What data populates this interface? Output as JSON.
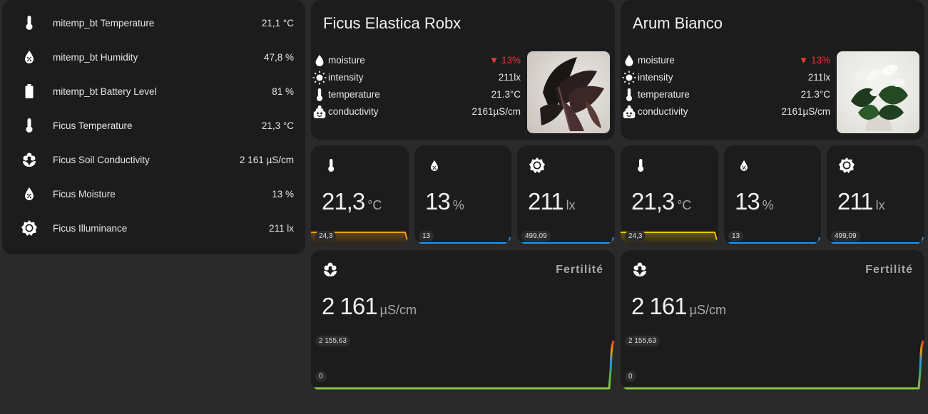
{
  "entities": [
    {
      "name": "mitemp_bt Temperature",
      "value": "21,1 °C",
      "icon": "thermometer-icon"
    },
    {
      "name": "mitemp_bt Humidity",
      "value": "47,8 %",
      "icon": "water-percent-icon"
    },
    {
      "name": "mitemp_bt Battery Level",
      "value": "81 %",
      "icon": "battery-icon"
    },
    {
      "name": "Ficus Temperature",
      "value": "21,3 °C",
      "icon": "thermometer-icon"
    },
    {
      "name": "Ficus Soil Conductivity",
      "value": "2 161 µS/cm",
      "icon": "flower-icon"
    },
    {
      "name": "Ficus Moisture",
      "value": "13 %",
      "icon": "water-percent-icon"
    },
    {
      "name": "Ficus Illuminance",
      "value": "211 lx",
      "icon": "brightness-icon"
    }
  ],
  "plants": [
    {
      "title": "Ficus Elastica Robx",
      "rows": [
        {
          "label": "moisture",
          "value": "13%",
          "alert": true,
          "icon": "water-icon"
        },
        {
          "label": "intensity",
          "value": "211lx",
          "alert": false,
          "icon": "sun-icon"
        },
        {
          "label": "temperature",
          "value": "21.3°C",
          "alert": false,
          "icon": "thermometer-icon"
        },
        {
          "label": "conductivity",
          "value": "2161µS/cm",
          "alert": false,
          "icon": "emoticon-poop-icon"
        }
      ],
      "sensors": [
        {
          "value": "21,3",
          "unit": "°C",
          "label": "24,3",
          "color": "#f39c12",
          "icon": "thermometer-icon"
        },
        {
          "value": "13",
          "unit": "%",
          "label": "13",
          "color": "#2196f3",
          "icon": "water-percent-icon"
        },
        {
          "value": "211",
          "unit": "lx",
          "label": "499,09",
          "color": "#2196f3",
          "icon": "brightness-icon"
        }
      ],
      "fertility": {
        "title": "Fertilité",
        "value": "2 161",
        "unit": "µS/cm",
        "max_label": "2 155,63",
        "min_label": "0",
        "icon": "flower-icon"
      }
    },
    {
      "title": "Arum Bianco",
      "rows": [
        {
          "label": "moisture",
          "value": "13%",
          "alert": true,
          "icon": "water-icon"
        },
        {
          "label": "intensity",
          "value": "211lx",
          "alert": false,
          "icon": "sun-icon"
        },
        {
          "label": "temperature",
          "value": "21.3°C",
          "alert": false,
          "icon": "thermometer-icon"
        },
        {
          "label": "conductivity",
          "value": "2161µS/cm",
          "alert": false,
          "icon": "emoticon-poop-icon"
        }
      ],
      "sensors": [
        {
          "value": "21,3",
          "unit": "°C",
          "label": "24,3",
          "color": "#f39c12",
          "icon": "thermometer-icon"
        },
        {
          "value": "13",
          "unit": "%",
          "label": "13",
          "color": "#2196f3",
          "icon": "water-percent-icon"
        },
        {
          "value": "211",
          "unit": "lx",
          "label": "499,09",
          "color": "#2196f3",
          "icon": "brightness-icon"
        }
      ],
      "fertility": {
        "title": "Fertilité",
        "value": "2 161",
        "unit": "µS/cm",
        "max_label": "2 155,63",
        "min_label": "0",
        "icon": "flower-icon"
      }
    }
  ],
  "alert_glyph": "▼"
}
